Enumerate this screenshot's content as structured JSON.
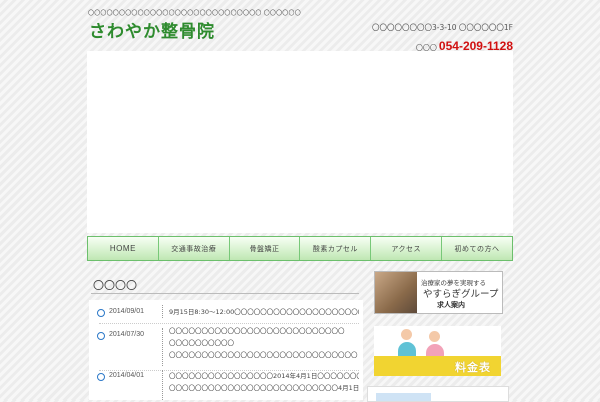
{
  "header": {
    "tagline": "〇〇〇〇〇〇〇〇〇〇〇〇〇〇〇〇〇〇〇〇〇〇〇〇〇〇〇〇 〇〇〇〇〇〇",
    "logo": "さわやか整骨院",
    "address": "〇〇〇〇〇〇〇〇3-3-10 〇〇〇〇〇〇1F",
    "tel_label": "〇〇〇",
    "tel_number": "054-209-1128"
  },
  "nav": {
    "items": [
      {
        "label": "HOME"
      },
      {
        "label": "交通事故治療"
      },
      {
        "label": "骨盤矯正"
      },
      {
        "label": "酸素カプセル"
      },
      {
        "label": "アクセス"
      },
      {
        "label": "初めての方へ"
      }
    ]
  },
  "news": {
    "title": "〇〇〇〇",
    "items": [
      {
        "date": "2014/09/01",
        "lines": [
          "9月15日8:30～12:00〇〇〇〇〇〇〇〇〇〇〇〇〇〇〇〇〇〇〇〇〇〇〇〇"
        ]
      },
      {
        "date": "2014/07/30",
        "lines": [
          "〇〇〇〇〇〇〇〇〇〇〇〇〇〇〇〇〇〇〇〇〇〇〇〇〇〇〇",
          "〇〇〇〇〇〇〇〇〇〇",
          "〇〇〇〇〇〇〇〇〇〇〇〇〇〇〇〇〇〇〇〇〇〇〇〇〇〇〇〇〇"
        ]
      },
      {
        "date": "2014/04/01",
        "lines": [
          "〇〇〇〇〇〇〇〇〇〇〇〇〇〇〇〇2014年4月1日〇〇〇〇〇〇〇〇〇〇〇〇〇〇〇〇〇〇〇〇",
          "〇〇〇〇〇〇〇〇〇〇〇〇〇〇〇〇〇〇〇〇〇〇〇〇〇〇4月1日〇〇〇〇〇〇〇〇〇〇〇"
        ]
      }
    ]
  },
  "sidebar": {
    "recruit": {
      "line1": "治療家の夢を実現する",
      "line2": "やすらぎグループ",
      "line3": "求人案内"
    },
    "price": {
      "label": "料金表"
    }
  }
}
